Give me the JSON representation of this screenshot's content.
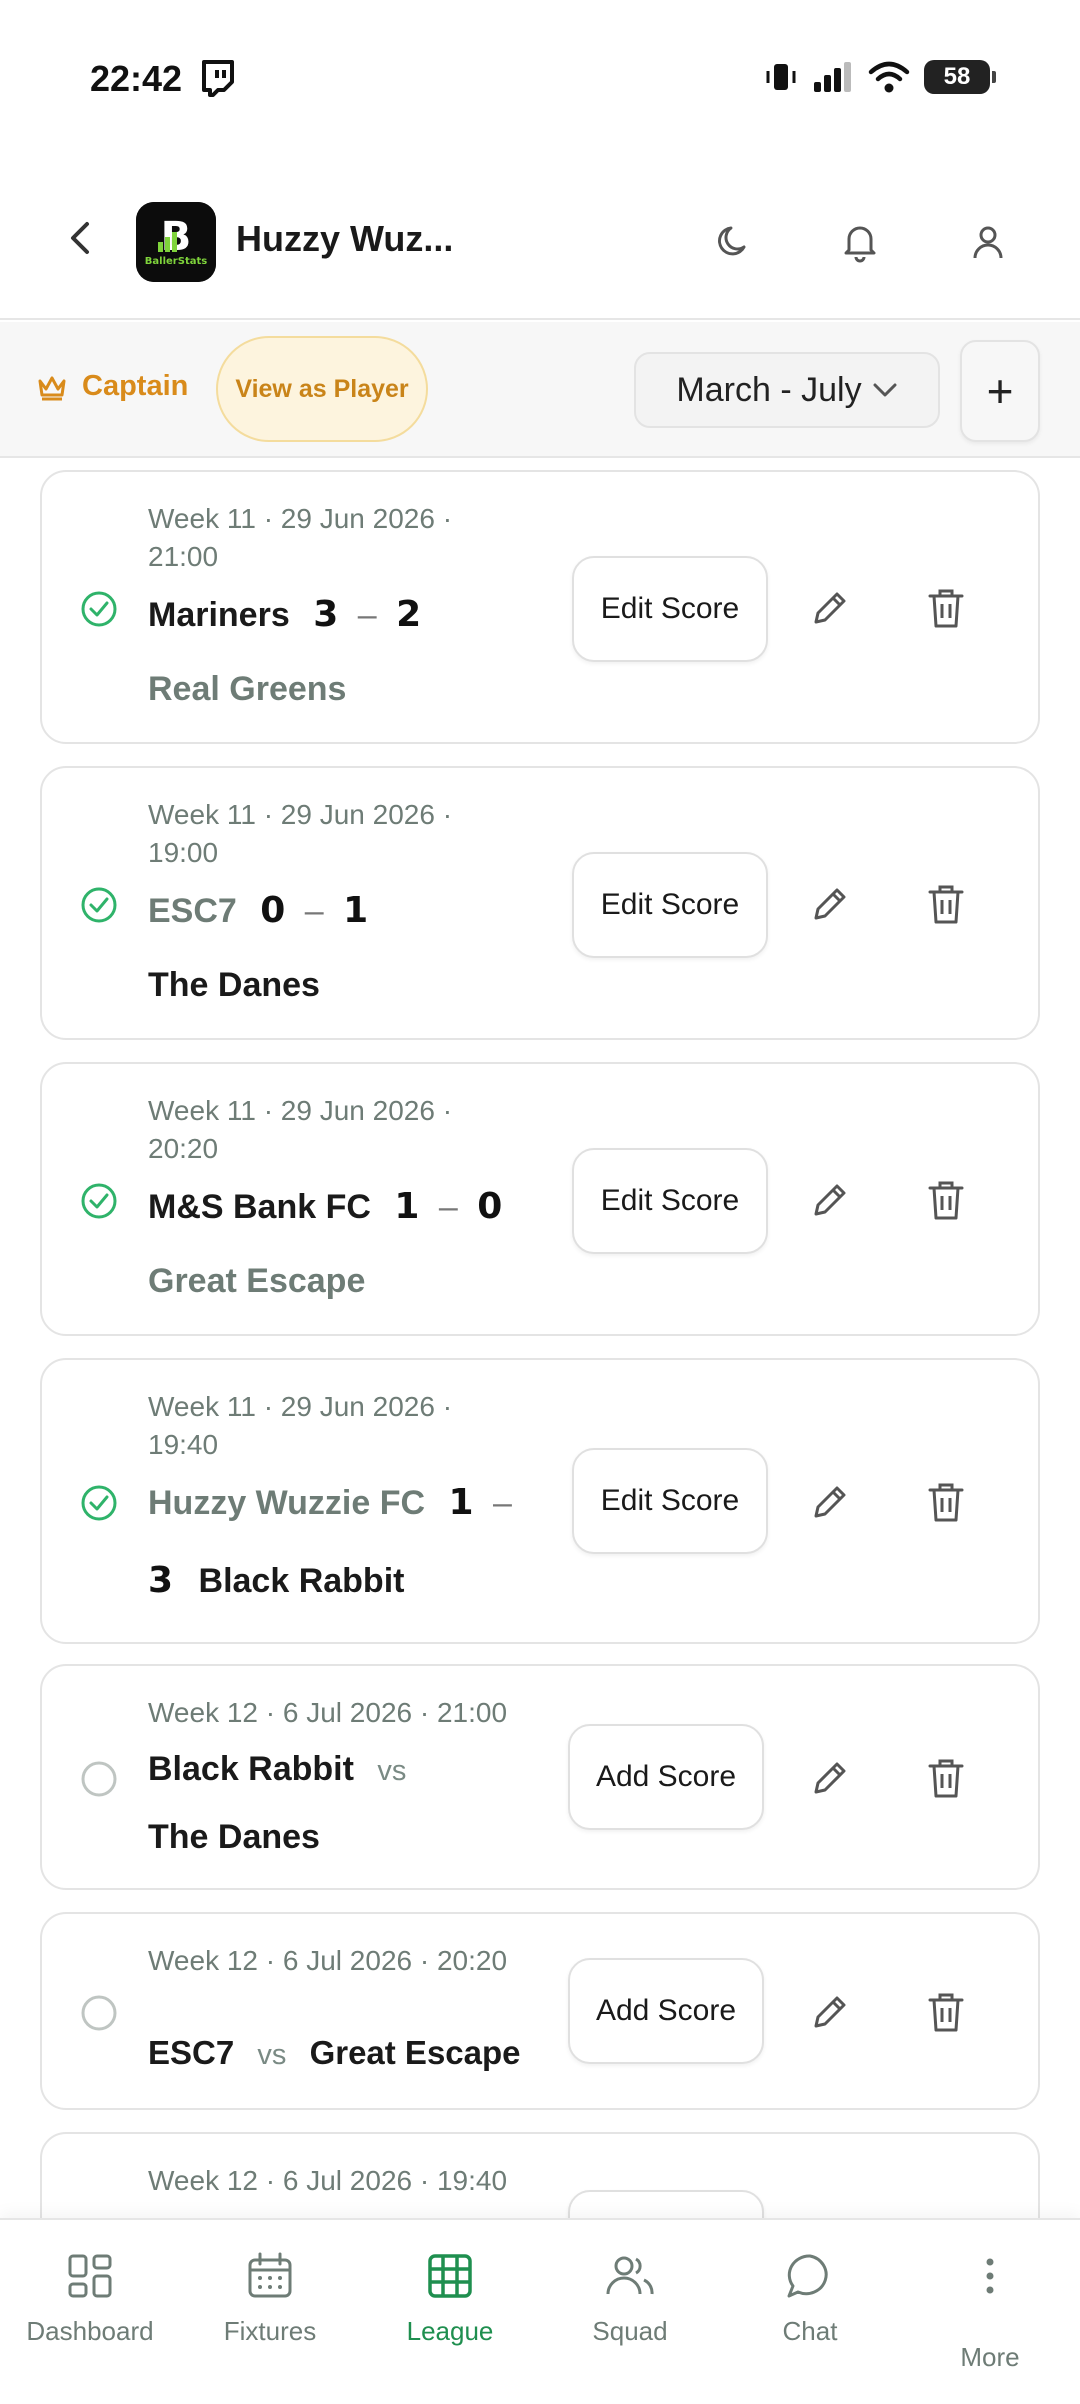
{
  "status_bar": {
    "time": "22:42",
    "battery": "58"
  },
  "header": {
    "team_name": "Huzzy Wuz..."
  },
  "toolbar": {
    "role_label": "Captain",
    "view_as_player_label": "View as Player",
    "season_label": "March - July",
    "add_label": "+"
  },
  "matches": [
    {
      "meta": "Week 11 · 29 Jun 2026 · 21:00",
      "home": "Mariners",
      "home_score": "3",
      "away_score": "2",
      "away": "Real Greens",
      "action": "Edit Score"
    },
    {
      "meta": "Week 11 · 29 Jun 2026 · 19:00",
      "home": "ESC7",
      "home_score": "0",
      "away_score": "1",
      "away": "The Danes",
      "action": "Edit Score"
    },
    {
      "meta": "Week 11 · 29 Jun 2026 · 20:20",
      "home": "M&S Bank FC",
      "home_score": "1",
      "away_score": "0",
      "away": "Great Escape",
      "action": "Edit Score"
    },
    {
      "meta": "Week 11 · 29 Jun 2026 · 19:40",
      "home": "Huzzy Wuzzie FC",
      "home_score": "1",
      "away_score": "3",
      "away": "Black Rabbit",
      "action": "Edit Score"
    },
    {
      "meta": "Week 12 · 6 Jul 2026 · 21:00",
      "home": "Black Rabbit",
      "vs": "vs",
      "away": "The Danes",
      "action": "Add Score"
    },
    {
      "meta": "Week 12 · 6 Jul 2026 · 20:20",
      "home": "ESC7",
      "vs": "vs",
      "away": "Great Escape",
      "action": "Add Score"
    },
    {
      "meta": "Week 12 · 6 Jul 2026 · 19:40"
    }
  ],
  "nav": {
    "items": [
      {
        "label": "Dashboard",
        "icon": "dashboard-icon"
      },
      {
        "label": "Fixtures",
        "icon": "calendar-icon"
      },
      {
        "label": "League",
        "icon": "table-icon",
        "active": true
      },
      {
        "label": "Squad",
        "icon": "users-icon"
      },
      {
        "label": "Chat",
        "icon": "chat-icon"
      },
      {
        "label": "More",
        "icon": "more-vertical-icon"
      }
    ]
  },
  "colors": {
    "accent_green": "#1f8f4f",
    "captain_orange": "#d98b1b",
    "muted_text": "#6e7c76",
    "check_green": "#2fb36a"
  }
}
